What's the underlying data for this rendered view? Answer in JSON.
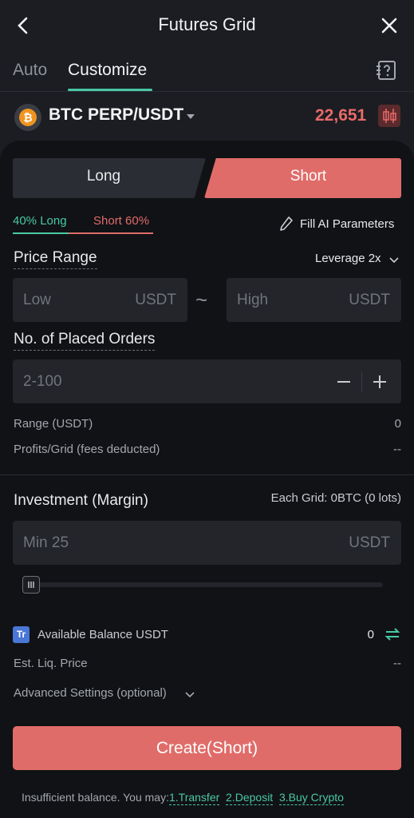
{
  "header": {
    "title": "Futures Grid"
  },
  "tabs": [
    {
      "label": "Auto",
      "active": false
    },
    {
      "label": "Customize",
      "active": true
    }
  ],
  "pair": {
    "coin_letter": "₿",
    "name": "BTC PERP/USDT",
    "price": "22,651"
  },
  "direction": {
    "long_label": "Long",
    "short_label": "Short",
    "selected": "Short"
  },
  "ratio": {
    "long": "40% Long",
    "short": "Short 60%"
  },
  "fill_ai": "Fill AI Parameters",
  "price_range": {
    "label": "Price Range",
    "leverage": "Leverage 2x",
    "low_placeholder": "Low",
    "high_placeholder": "High",
    "unit": "USDT",
    "separator": "~"
  },
  "orders": {
    "label": "No. of Placed Orders",
    "placeholder": "2-100"
  },
  "info": {
    "range_label": "Range (USDT)",
    "range_value": "0",
    "profit_label": "Profits/Grid (fees deducted)",
    "profit_value": "--"
  },
  "investment": {
    "label": "Investment (Margin)",
    "each_grid": "Each Grid: 0BTC (0 lots)",
    "placeholder": "Min 25",
    "unit": "USDT",
    "slider_value": 0
  },
  "balance": {
    "badge": "Tr",
    "label": "Available Balance USDT",
    "value": "0",
    "liq_label": "Est. Liq. Price",
    "liq_value": "--"
  },
  "advanced": "Advanced Settings (optional)",
  "create_button": "Create(Short)",
  "footer": {
    "text": "Insufficient balance. You may:",
    "link1": "1.Transfer",
    "link2": "2.Deposit",
    "link3": "3.Buy Crypto"
  },
  "colors": {
    "accent_green": "#49c9a3",
    "accent_red": "#e06c69",
    "price_red": "#e86a6a"
  }
}
